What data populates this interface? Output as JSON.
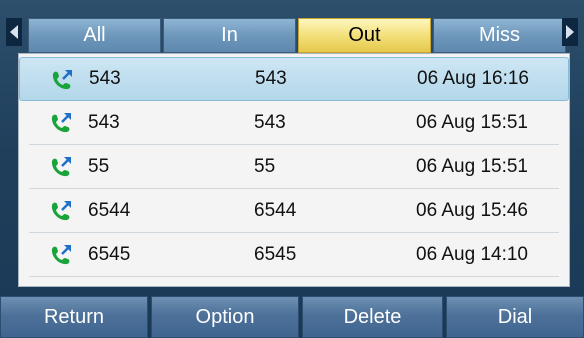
{
  "tabs": [
    {
      "label": "All"
    },
    {
      "label": "In"
    },
    {
      "label": "Out"
    },
    {
      "label": "Miss"
    }
  ],
  "active_tab": "Out",
  "calls": [
    {
      "name": "543",
      "number": "543",
      "time": "06 Aug 16:16",
      "icon": "outgoing-call-icon",
      "selected": true
    },
    {
      "name": "543",
      "number": "543",
      "time": "06 Aug 15:51",
      "icon": "outgoing-call-icon",
      "selected": false
    },
    {
      "name": "55",
      "number": "55",
      "time": "06 Aug 15:51",
      "icon": "outgoing-call-icon",
      "selected": false
    },
    {
      "name": "6544",
      "number": "6544",
      "time": "06 Aug 15:46",
      "icon": "outgoing-call-icon",
      "selected": false
    },
    {
      "name": "6545",
      "number": "6545",
      "time": "06 Aug 14:10",
      "icon": "outgoing-call-icon",
      "selected": false
    }
  ],
  "softkeys": [
    {
      "label": "Return"
    },
    {
      "label": "Option"
    },
    {
      "label": "Delete"
    },
    {
      "label": "Dial"
    }
  ],
  "colors": {
    "phone_green": "#1aa33a",
    "arrow_blue": "#1e70c8",
    "active_tab": "#f2e07a"
  }
}
